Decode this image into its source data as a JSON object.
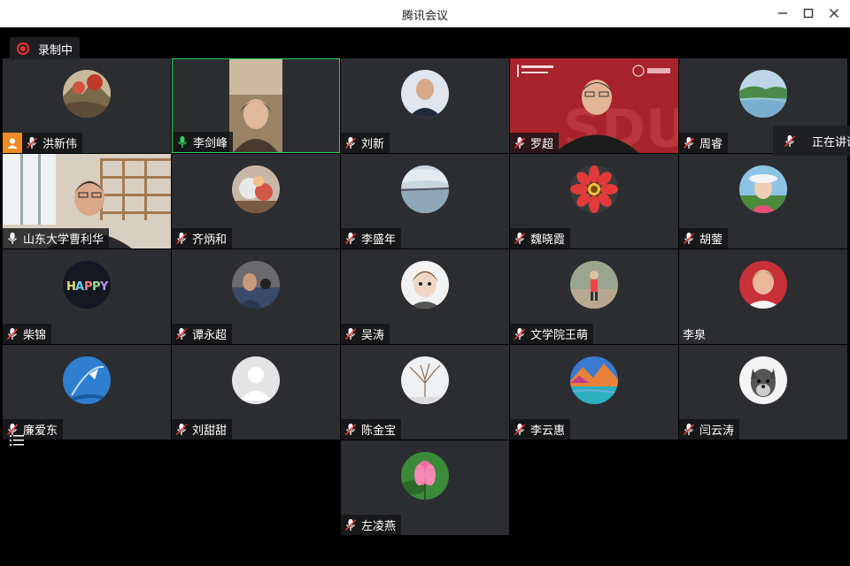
{
  "window": {
    "title": "腾讯会议"
  },
  "recording": {
    "label": "录制中"
  },
  "speaking": {
    "label": "正在讲话"
  },
  "participants": [
    {
      "name": "洪新伟",
      "mic": "off",
      "host": true
    },
    {
      "name": "李剑峰",
      "mic": "on",
      "active": true
    },
    {
      "name": "刘新",
      "mic": "off"
    },
    {
      "name": "罗超",
      "mic": "off"
    },
    {
      "name": "周睿",
      "mic": "off"
    },
    {
      "name": "山东大学曹利华",
      "mic": "on"
    },
    {
      "name": "齐炳和",
      "mic": "off"
    },
    {
      "name": "李盛年",
      "mic": "off"
    },
    {
      "name": "魏晓霞",
      "mic": "off"
    },
    {
      "name": "胡蓥",
      "mic": "off"
    },
    {
      "name": "柴锦",
      "mic": "off"
    },
    {
      "name": "谭永超",
      "mic": "off"
    },
    {
      "name": "吴涛",
      "mic": "off"
    },
    {
      "name": "文学院王萌",
      "mic": "off"
    },
    {
      "name": "李泉",
      "mic": "none"
    },
    {
      "name": "廉爱东",
      "mic": "off"
    },
    {
      "name": "刘甜甜",
      "mic": "off"
    },
    {
      "name": "陈金宝",
      "mic": "off"
    },
    {
      "name": "李云惠",
      "mic": "off"
    },
    {
      "name": "闫云涛",
      "mic": "off"
    },
    {
      "name": "左凌燕",
      "mic": "off"
    }
  ],
  "colors": {
    "tile_bg": "#2b2d31",
    "active_border": "#2fd05a",
    "record_red": "#e33333",
    "host_orange": "#f08a24",
    "mic_on_green": "#2fd05a"
  },
  "icons": {
    "minimize": "minimize-icon",
    "maximize": "maximize-icon",
    "close": "close-icon",
    "mic_off": "mic-off-icon",
    "mic_on": "mic-on-icon",
    "host": "host-user-icon",
    "record": "record-icon",
    "list": "list-icon"
  }
}
